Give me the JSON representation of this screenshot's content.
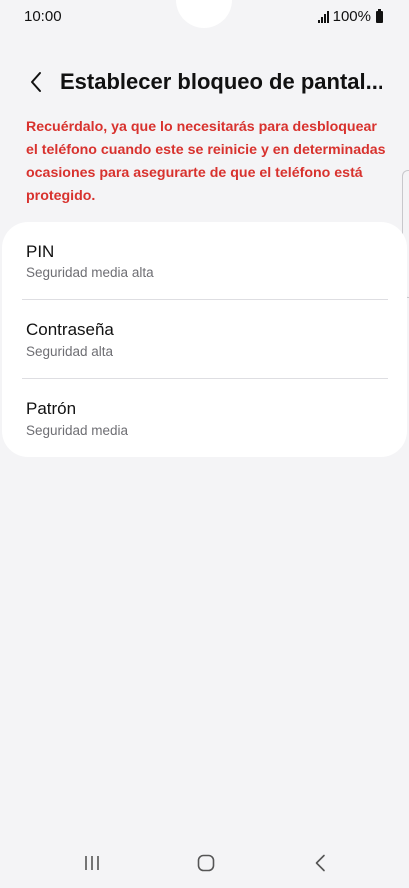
{
  "status": {
    "time": "10:00",
    "battery": "100%"
  },
  "header": {
    "title": "Establecer bloqueo de pantal..."
  },
  "warning": {
    "text": "Recuérdalo, ya que lo necesitarás para desbloquear el teléfono cuando este se reinicie y en determinadas ocasiones para asegurarte de que el teléfono está protegido."
  },
  "options": [
    {
      "title": "PIN",
      "subtitle": "Seguridad media alta"
    },
    {
      "title": "Contraseña",
      "subtitle": "Seguridad alta"
    },
    {
      "title": "Patrón",
      "subtitle": "Seguridad media"
    }
  ],
  "navbar": {
    "icons": [
      "recent-apps-icon",
      "home-icon",
      "back-icon"
    ]
  },
  "colors": {
    "warning": "#d8322e",
    "background": "#f4f4f6",
    "card": "#ffffff"
  }
}
